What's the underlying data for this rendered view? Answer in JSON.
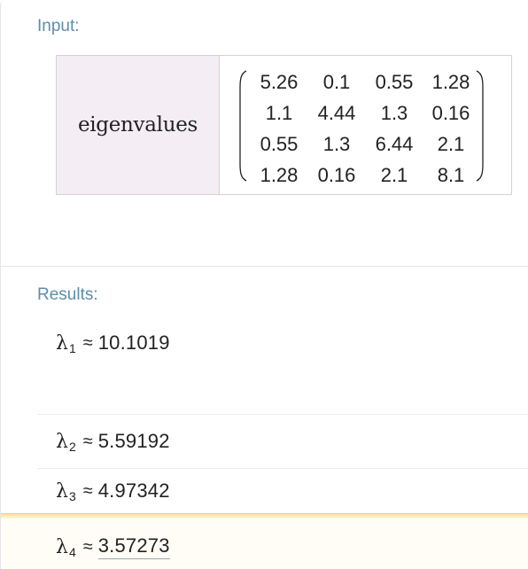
{
  "input_pod": {
    "title": "Input:",
    "label": "eigenvalues",
    "matrix": [
      [
        "5.26",
        "0.1",
        "0.55",
        "1.28"
      ],
      [
        "1.1",
        "4.44",
        "1.3",
        "0.16"
      ],
      [
        "0.55",
        "1.3",
        "6.44",
        "2.1"
      ],
      [
        "1.28",
        "0.16",
        "2.1",
        "8.1"
      ]
    ]
  },
  "results_pod": {
    "title": "Results:",
    "approx_symbol": "≈",
    "lambda_symbol": "λ",
    "results": [
      {
        "sub": "1",
        "value": "10.1019"
      },
      {
        "sub": "2",
        "value": "5.59192"
      },
      {
        "sub": "3",
        "value": "4.97342"
      },
      {
        "sub": "4",
        "value": "3.57273"
      }
    ]
  },
  "colors": {
    "pod_title": "#5d8eab",
    "label_cell_bg": "#f4eef4",
    "highlight": "#fbe3a5"
  }
}
